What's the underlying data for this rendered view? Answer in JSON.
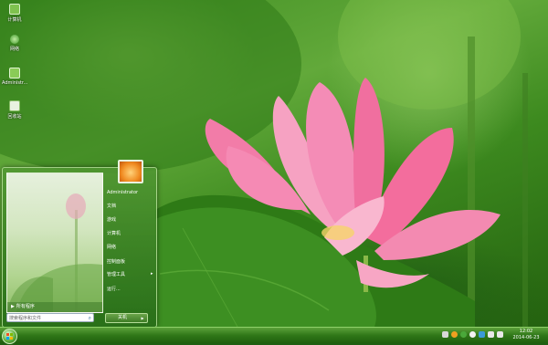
{
  "desktop": {
    "icons": [
      {
        "label": "计算机",
        "icon": "computer-icon"
      },
      {
        "label": "网络",
        "icon": "network-icon"
      },
      {
        "label": "Administr...",
        "icon": "user-folder-icon"
      },
      {
        "label": "回收站",
        "icon": "recycle-bin-icon"
      }
    ]
  },
  "start_menu": {
    "all_programs": "所有程序",
    "search_placeholder": "搜索程序和文件",
    "right_items": [
      {
        "label": "Administrator"
      },
      {
        "label": "文档"
      },
      {
        "label": "游戏"
      },
      {
        "label": "计算机"
      },
      {
        "label": "网络"
      },
      {
        "label": "控制面板"
      },
      {
        "label": "管理工具",
        "submenu": "▸"
      },
      {
        "label": "运行..."
      }
    ],
    "shutdown_label": "关机"
  },
  "taskbar": {
    "time": "12:02",
    "date": "2014-06-23"
  },
  "colors": {
    "accent": "#3f7d26",
    "taskbar": "#2f7718"
  }
}
